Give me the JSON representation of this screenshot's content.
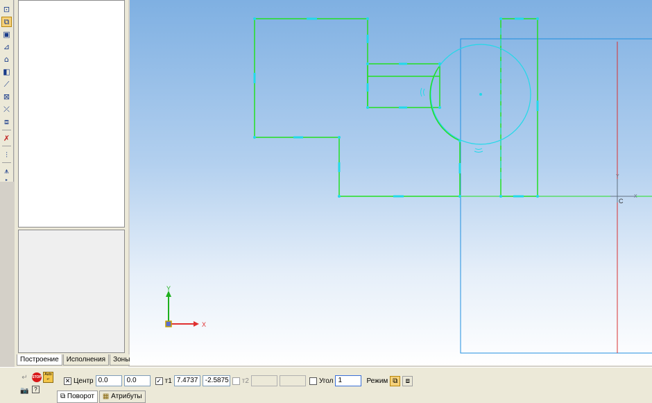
{
  "tree_tabs": [
    "Построение",
    "Исполнения",
    "Зоны"
  ],
  "canvas": {
    "axis_x_label": "X",
    "axis_y_label": "Y",
    "lcs_x_label": "X",
    "lcs_y_label": "Y",
    "point_label": "C",
    "colors": {
      "geometry": "#22e022",
      "highlight": "#22d9e8",
      "frame": "#1f8fe0",
      "centerline": "#d83030"
    }
  },
  "toolbar_left_icons": [
    "zoom-window-icon",
    "rotate-view-icon",
    "pan-icon",
    "show-all-icon",
    "refresh-icon",
    "select-icon",
    "line-icon",
    "circle-icon",
    "dimension-icon",
    "copy-icon",
    "delete-icon",
    "measure-icon",
    "filter-icon"
  ],
  "propbar": {
    "stop_label": "STOP",
    "auto_label": "Auto",
    "center_label": "Центр",
    "center_x": "0.0",
    "center_y": "0.0",
    "t1_label": "т1",
    "t1_x": "7.4737",
    "t1_y": "-2.5875",
    "t2_label": "т2",
    "angle_label": "Угол",
    "angle_value": "1",
    "mode_label": "Режим"
  },
  "bottom_tabs": [
    "Поворот",
    "Атрибуты"
  ]
}
